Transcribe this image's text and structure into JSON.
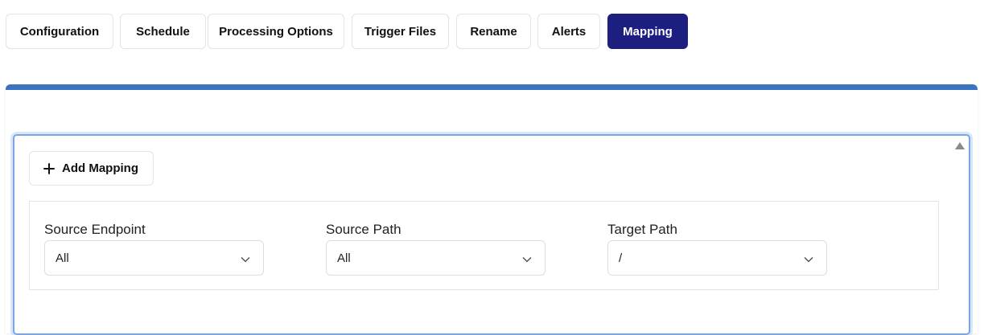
{
  "tabs": [
    {
      "label": "Configuration",
      "active": false
    },
    {
      "label": "Schedule",
      "active": false
    },
    {
      "label": "Processing Options",
      "active": false
    },
    {
      "label": "Trigger Files",
      "active": false
    },
    {
      "label": "Rename",
      "active": false
    },
    {
      "label": "Alerts",
      "active": false
    },
    {
      "label": "Mapping",
      "active": true
    }
  ],
  "colors": {
    "active_tab": "#1c1f80",
    "panel_accent": "#3a73c0",
    "focus_border": "#7aa6e6"
  },
  "mapping": {
    "add_button_label": "Add Mapping",
    "add_button_icon": "plus-icon",
    "fields": [
      {
        "label": "Source Endpoint",
        "value": "All",
        "icon": "chevron-down-icon"
      },
      {
        "label": "Source Path",
        "value": "All",
        "icon": "chevron-down-icon"
      },
      {
        "label": "Target Path",
        "value": "/",
        "icon": "chevron-down-icon"
      }
    ]
  },
  "scrollbar": {
    "icon": "scroll-up-arrow-icon"
  }
}
